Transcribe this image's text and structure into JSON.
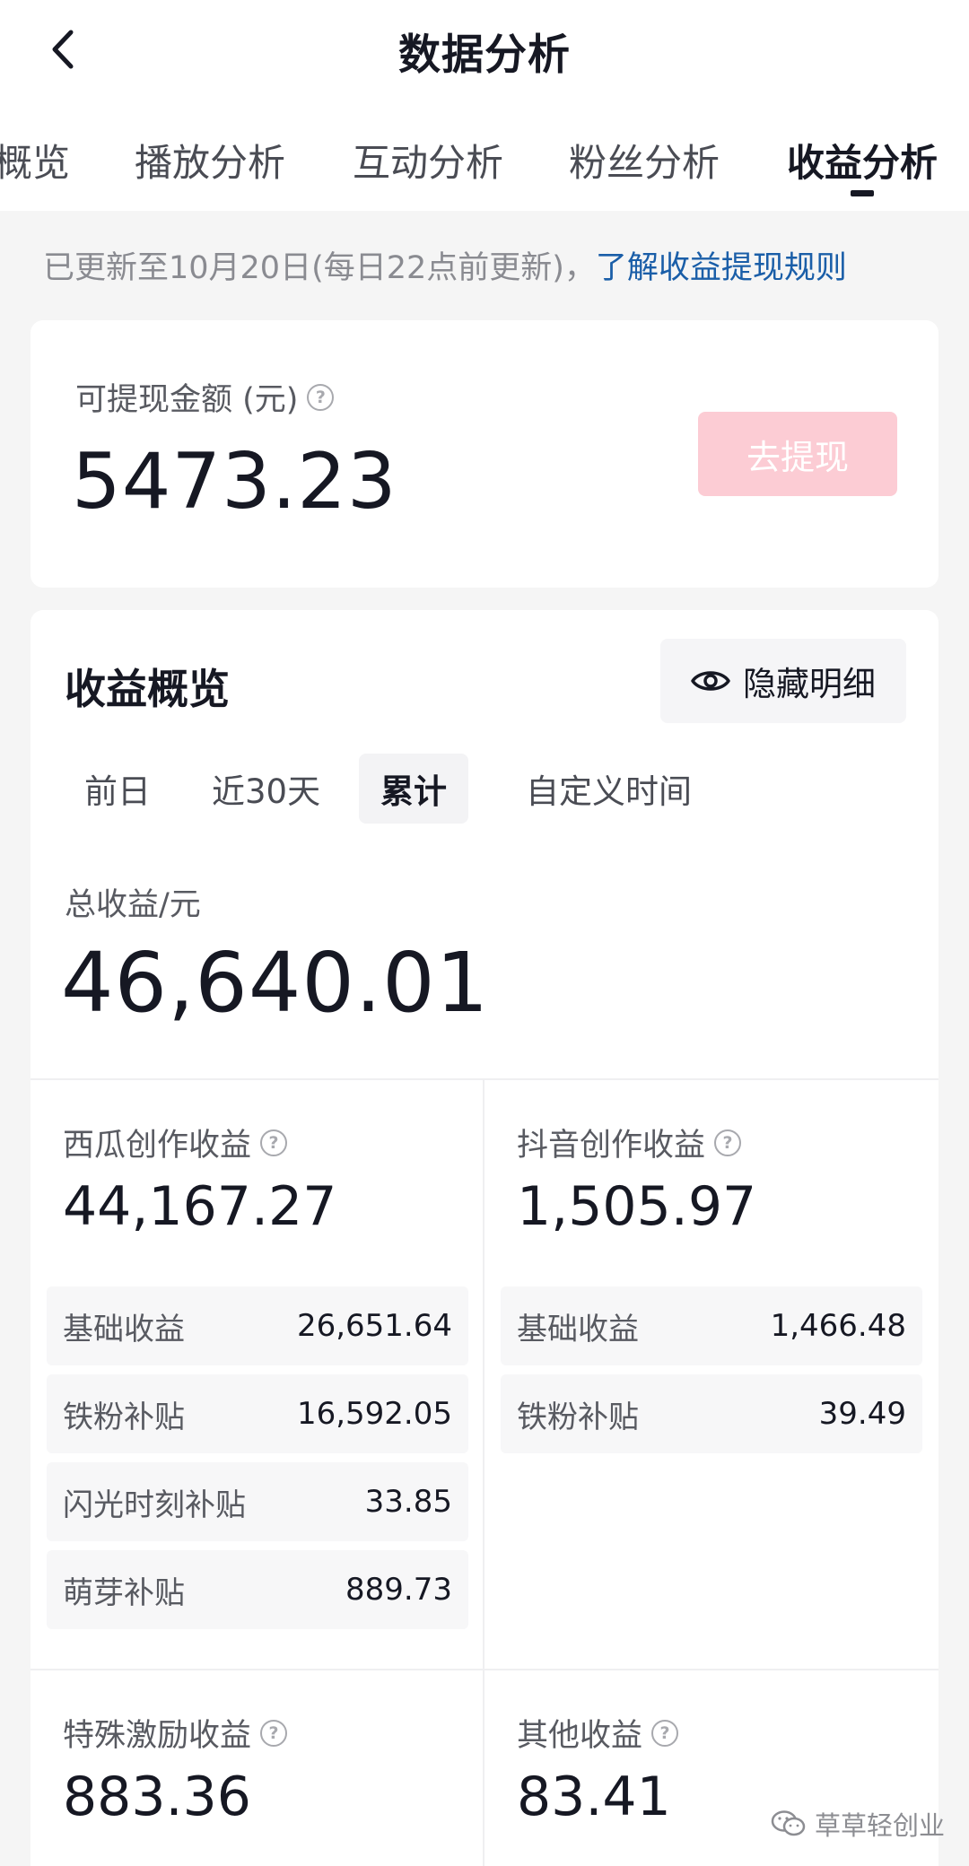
{
  "header": {
    "title": "数据分析"
  },
  "tabs": [
    {
      "label": "概览"
    },
    {
      "label": "播放分析"
    },
    {
      "label": "互动分析"
    },
    {
      "label": "粉丝分析"
    },
    {
      "label": "收益分析",
      "active": true
    }
  ],
  "notice": {
    "text": "已更新至10月20日(每日22点前更新)，",
    "link": "了解收益提现规则"
  },
  "withdraw": {
    "label": "可提现金额 (元)",
    "amount": "5473.23",
    "button": "去提现"
  },
  "overview": {
    "title": "收益概览",
    "hide_label": "隐藏明细",
    "periods": [
      "前日",
      "近30天",
      "累计",
      "自定义时间"
    ],
    "active_period": "累计",
    "total_label": "总收益/元",
    "total_value": "46,640.01",
    "sections": [
      {
        "label": "西瓜创作收益",
        "value": "44,167.27",
        "items": [
          {
            "name": "基础收益",
            "value": "26,651.64"
          },
          {
            "name": "铁粉补贴",
            "value": "16,592.05"
          },
          {
            "name": "闪光时刻补贴",
            "value": "33.85"
          },
          {
            "name": "萌芽补贴",
            "value": "889.73"
          }
        ]
      },
      {
        "label": "抖音创作收益",
        "value": "1,505.97",
        "items": [
          {
            "name": "基础收益",
            "value": "1,466.48"
          },
          {
            "name": "铁粉补贴",
            "value": "39.49"
          }
        ]
      },
      {
        "label": "特殊激励收益",
        "value": "883.36"
      },
      {
        "label": "其他收益",
        "value": "83.41"
      }
    ]
  },
  "watermark": {
    "text": "草草轻创业"
  },
  "colors": {
    "accent_link": "#1a5ea8",
    "withdraw_button": "#fcccd4",
    "text_primary": "#161823",
    "text_secondary": "#585a61"
  }
}
